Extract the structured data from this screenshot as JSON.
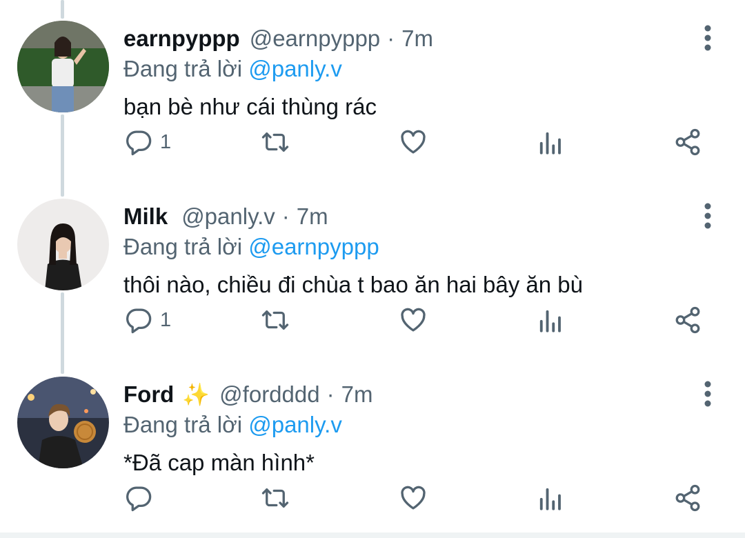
{
  "tweets": [
    {
      "display_name": "earnpyppp",
      "emoji": "",
      "handle": "@earnpyppp",
      "time": "7m",
      "reply_prefix": "Đang trả lời",
      "reply_to": "@panly.v",
      "text": "bạn bè như cái thùng rác",
      "reply_count": "1"
    },
    {
      "display_name": "Milk",
      "emoji": "",
      "handle": "@panly.v",
      "time": "7m",
      "reply_prefix": "Đang trả lời",
      "reply_to": "@earnpyppp",
      "text": "thôi nào, chiều đi chùa t bao ăn hai bây ăn bù",
      "reply_count": "1"
    },
    {
      "display_name": "Ford",
      "emoji": "✨",
      "handle": "@fordddd",
      "time": "7m",
      "reply_prefix": "Đang trả lời",
      "reply_to": "@panly.v",
      "text": "*Đã cap màn hình*",
      "reply_count": ""
    }
  ],
  "separator": "·",
  "icons": {
    "reply": "reply-icon",
    "retweet": "retweet-icon",
    "like": "heart-icon",
    "views": "bar-chart-icon",
    "share": "share-icon",
    "more": "more-vertical-icon"
  },
  "colors": {
    "text": "#0f1419",
    "secondary": "#536471",
    "link": "#1d9bf0",
    "thread_line": "#cfd9de"
  }
}
